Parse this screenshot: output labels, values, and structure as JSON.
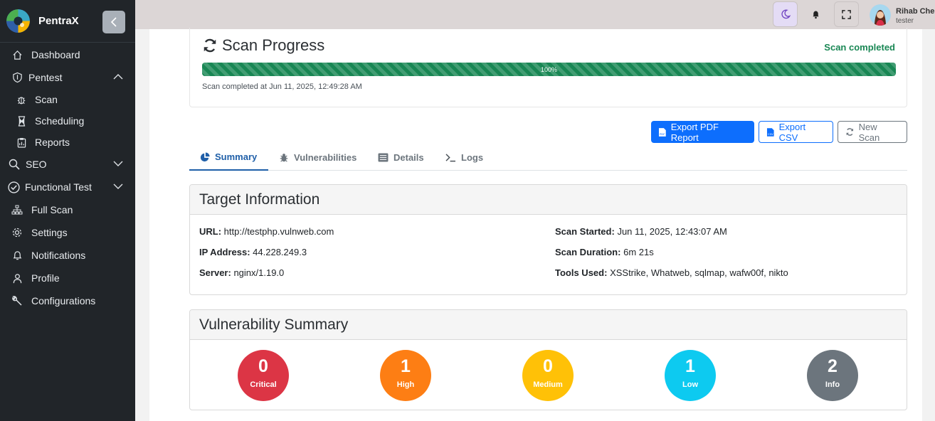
{
  "app": {
    "name": "PentraX"
  },
  "sidebar": {
    "items": [
      {
        "label": "Dashboard"
      },
      {
        "label": "Pentest"
      },
      {
        "label": "Scan"
      },
      {
        "label": "Scheduling"
      },
      {
        "label": "Reports"
      },
      {
        "label": "SEO"
      },
      {
        "label": "Functional Test"
      },
      {
        "label": "Full Scan"
      },
      {
        "label": "Settings"
      },
      {
        "label": "Notifications"
      },
      {
        "label": "Profile"
      },
      {
        "label": "Configurations"
      }
    ]
  },
  "topbar": {
    "user_name": "Rihab Che",
    "user_role": "tester",
    "icons": [
      "moon-icon",
      "bell-icon",
      "fullscreen-icon"
    ]
  },
  "scan_progress": {
    "title": "Scan Progress",
    "status": "Scan completed",
    "progress": 1.0,
    "progress_label": "100%",
    "completed_text": "Scan completed at Jun 11, 2025, 12:49:28 AM"
  },
  "actions": {
    "export_pdf": "Export PDF Report",
    "export_csv": "Export CSV",
    "new_scan": "New Scan"
  },
  "tabs": [
    {
      "label": "Summary",
      "active": true
    },
    {
      "label": "Vulnerabilities"
    },
    {
      "label": "Details"
    },
    {
      "label": "Logs"
    }
  ],
  "target_info": {
    "title": "Target Information",
    "url_label": "URL:",
    "url": "http://testphp.vulnweb.com",
    "ip_label": "IP Address:",
    "ip": "44.228.249.3",
    "server_label": "Server:",
    "server": "nginx/1.19.0",
    "started_label": "Scan Started:",
    "started": "Jun 11, 2025, 12:43:07 AM",
    "duration_label": "Scan Duration:",
    "duration": "6m 21s",
    "tools_label": "Tools Used:",
    "tools": "XSStrike, Whatweb, sqlmap, wafw00f, nikto"
  },
  "vuln_summary": {
    "title": "Vulnerability Summary",
    "levels": [
      {
        "count": "0",
        "label": "Critical",
        "color": "#dc3545"
      },
      {
        "count": "1",
        "label": "High",
        "color": "#fd7e14"
      },
      {
        "count": "0",
        "label": "Medium",
        "color": "#ffc107"
      },
      {
        "count": "1",
        "label": "Low",
        "color": "#0dcaf0"
      },
      {
        "count": "2",
        "label": "Info",
        "color": "#6c757d"
      }
    ]
  }
}
